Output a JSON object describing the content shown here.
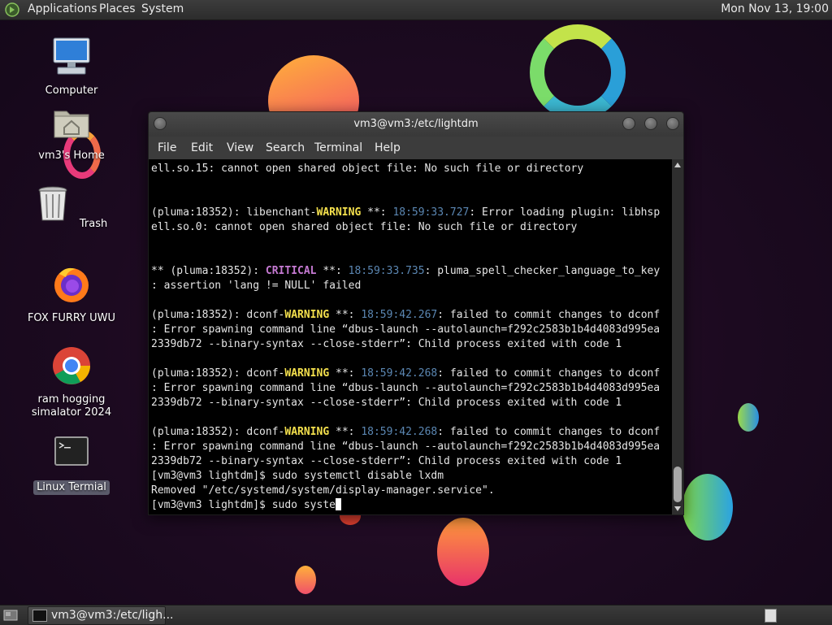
{
  "top_panel": {
    "menus": [
      "Applications",
      "Places",
      "System"
    ],
    "clock": "Mon Nov 13, 19:00"
  },
  "desktop_icons": [
    {
      "label": "Computer",
      "icon": "computer-icon"
    },
    {
      "label": "vm3's Home",
      "icon": "home-folder-icon"
    },
    {
      "label": "Trash",
      "icon": "trash-icon"
    },
    {
      "label": "FOX FURRY UWU",
      "icon": "firefox-icon"
    },
    {
      "label": "ram hogging simalator 2024",
      "icon": "chrome-icon"
    },
    {
      "label": "Linux Termial",
      "icon": "terminal-icon"
    }
  ],
  "terminal": {
    "title": "vm3@vm3:/etc/lightdm",
    "menu": [
      "File",
      "Edit",
      "View",
      "Search",
      "Terminal",
      "Help"
    ],
    "lines": [
      [
        {
          "t": "ell.so.15: cannot open shared object file: No such file or directory"
        }
      ],
      [],
      [],
      [
        {
          "t": "(pluma:18352): libenchant-"
        },
        {
          "t": "WARNING",
          "c": "warn"
        },
        {
          "t": " **: "
        },
        {
          "t": "18:59:33.727",
          "c": "ts"
        },
        {
          "t": ": Error loading plugin: libhsp"
        }
      ],
      [
        {
          "t": "ell.so.0: cannot open shared object file: No such file or directory"
        }
      ],
      [],
      [],
      [
        {
          "t": "** (pluma:18352): "
        },
        {
          "t": "CRITICAL",
          "c": "crit"
        },
        {
          "t": " **: "
        },
        {
          "t": "18:59:33.735",
          "c": "ts"
        },
        {
          "t": ": pluma_spell_checker_language_to_key"
        }
      ],
      [
        {
          "t": ": assertion 'lang != NULL' failed"
        }
      ],
      [],
      [
        {
          "t": "(pluma:18352): dconf-"
        },
        {
          "t": "WARNING",
          "c": "warn"
        },
        {
          "t": " **: "
        },
        {
          "t": "18:59:42.267",
          "c": "ts"
        },
        {
          "t": ": failed to commit changes to dconf"
        }
      ],
      [
        {
          "t": ": Error spawning command line “dbus-launch --autolaunch=f292c2583b1b4d4083d995ea"
        }
      ],
      [
        {
          "t": "2339db72 --binary-syntax --close-stderr”: Child process exited with code 1"
        }
      ],
      [],
      [
        {
          "t": "(pluma:18352): dconf-"
        },
        {
          "t": "WARNING",
          "c": "warn"
        },
        {
          "t": " **: "
        },
        {
          "t": "18:59:42.268",
          "c": "ts"
        },
        {
          "t": ": failed to commit changes to dconf"
        }
      ],
      [
        {
          "t": ": Error spawning command line “dbus-launch --autolaunch=f292c2583b1b4d4083d995ea"
        }
      ],
      [
        {
          "t": "2339db72 --binary-syntax --close-stderr”: Child process exited with code 1"
        }
      ],
      [],
      [
        {
          "t": "(pluma:18352): dconf-"
        },
        {
          "t": "WARNING",
          "c": "warn"
        },
        {
          "t": " **: "
        },
        {
          "t": "18:59:42.268",
          "c": "ts"
        },
        {
          "t": ": failed to commit changes to dconf"
        }
      ],
      [
        {
          "t": ": Error spawning command line “dbus-launch --autolaunch=f292c2583b1b4d4083d995ea"
        }
      ],
      [
        {
          "t": "2339db72 --binary-syntax --close-stderr”: Child process exited with code 1"
        }
      ],
      [
        {
          "t": "[vm3@vm3 lightdm]$ sudo systemctl disable lxdm"
        }
      ],
      [
        {
          "t": "Removed \"/etc/systemd/system/display-manager.service\"."
        }
      ],
      [
        {
          "t": "[vm3@vm3 lightdm]$ sudo syste"
        }
      ]
    ]
  },
  "taskbar": {
    "task_label": "vm3@vm3:/etc/ligh..."
  },
  "colors": {
    "warning": "#f4e04d",
    "critical": "#c67ad3",
    "timestamp": "#5b87b3",
    "terminal_bg": "#000000"
  }
}
